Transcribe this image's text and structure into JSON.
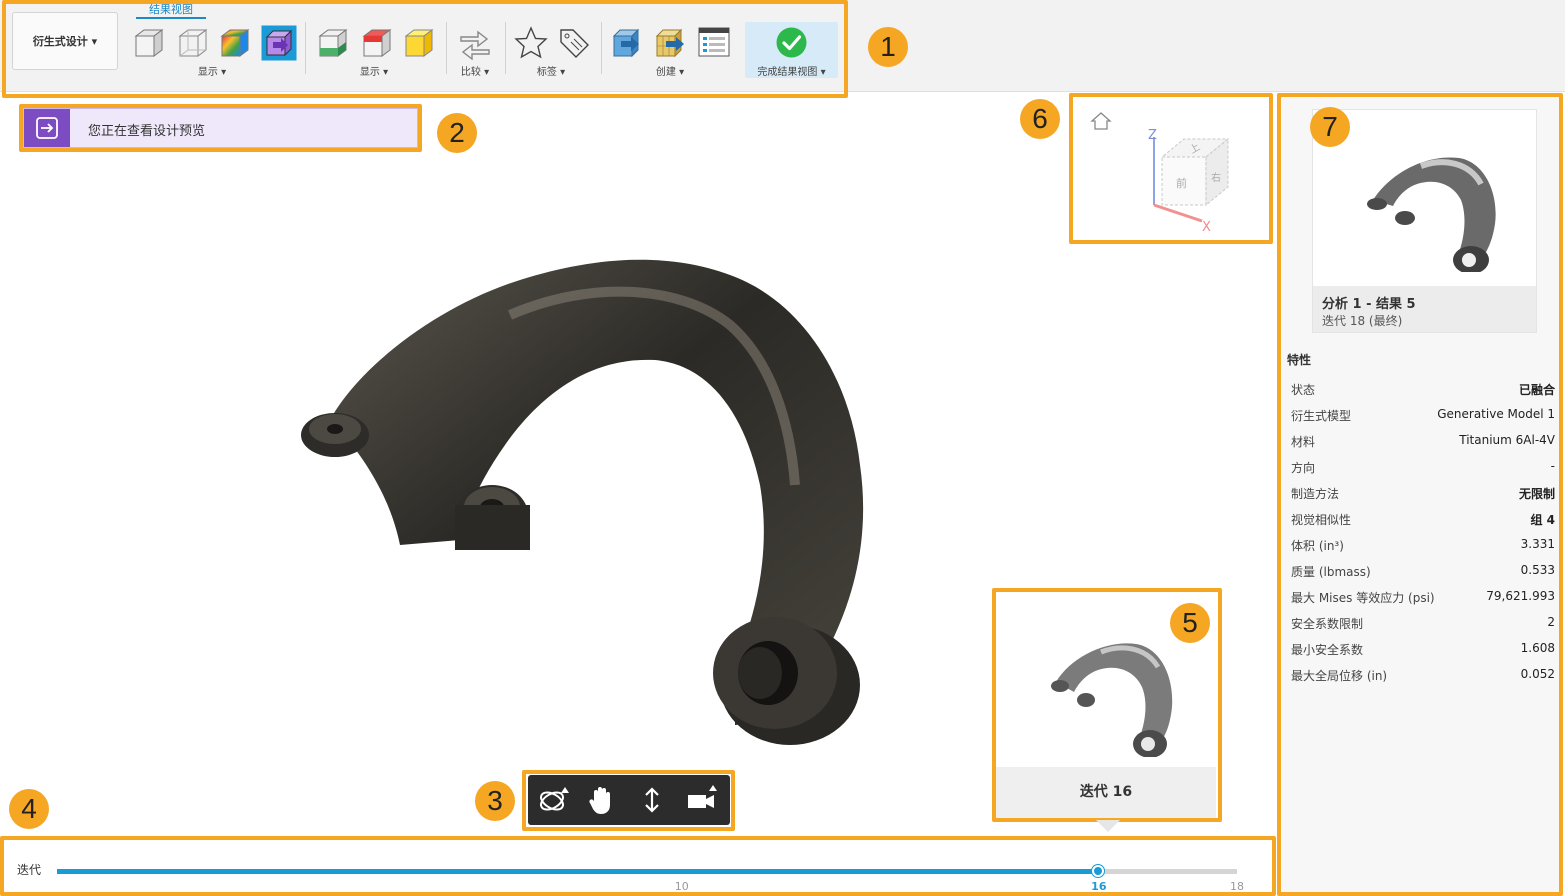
{
  "toolbar": {
    "workspace_label": "衍生式设计 ▾",
    "active_tab": "结果视图",
    "groups": {
      "display1": "显示 ▾",
      "display2": "显示 ▾",
      "compare": "比较 ▾",
      "label": "标签 ▾",
      "create": "创建 ▾",
      "finish": "完成结果视图 ▾"
    }
  },
  "banner": {
    "text": "您正在查看设计预览"
  },
  "callouts": [
    "1",
    "2",
    "3",
    "4",
    "5",
    "6",
    "7"
  ],
  "viewcube": {
    "z_label": "Z",
    "x_label": "X",
    "top_face": "上",
    "front_face": "前",
    "right_face": "右"
  },
  "thumbnail": {
    "label": "迭代 16"
  },
  "slider": {
    "label": "迭代",
    "min": 1,
    "max": 18,
    "value": 16,
    "tick_labels": [
      "10",
      "16",
      "18"
    ]
  },
  "panel": {
    "card_title": "分析 1 - 结果 5",
    "card_subtitle": "迭代 18 (最终)",
    "section_title": "特性",
    "properties": [
      {
        "key": "状态",
        "value": "已融合"
      },
      {
        "key": "衍生式模型",
        "value": "Generative Model 1"
      },
      {
        "key": "材料",
        "value": "Titanium 6Al-4V"
      },
      {
        "key": "方向",
        "value": "-"
      },
      {
        "key": "制造方法",
        "value": "无限制"
      },
      {
        "key": "视觉相似性",
        "value": "组 4"
      },
      {
        "key": "体积 (in³)",
        "value": "3.331"
      },
      {
        "key": "质量 (lbmass)",
        "value": "0.533"
      },
      {
        "key": "最大 Mises 等效应力 (psi)",
        "value": "79,621.993"
      },
      {
        "key": "安全系数限制",
        "value": "2"
      },
      {
        "key": "最小安全系数",
        "value": "1.608"
      },
      {
        "key": "最大全局位移 (in)",
        "value": "0.052"
      }
    ]
  },
  "colors": {
    "accent": "#f5a623",
    "blue": "#1a9ad6",
    "purple": "#7d4cc2",
    "success": "#2db84c"
  }
}
